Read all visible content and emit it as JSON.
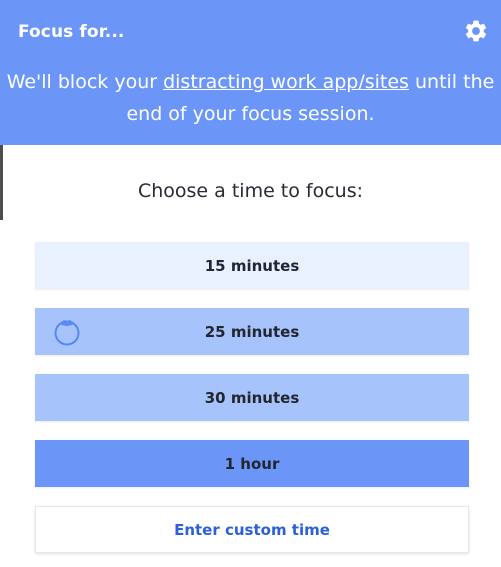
{
  "header": {
    "title": "Focus for...",
    "desc_before": "We'll block your ",
    "desc_link": "distracting work app/sites",
    "desc_after": " until the end of your focus session."
  },
  "prompt": "Choose a time to focus:",
  "options": [
    {
      "label": "15 minutes"
    },
    {
      "label": "25 minutes"
    },
    {
      "label": "30 minutes"
    },
    {
      "label": "1 hour"
    }
  ],
  "custom_label": "Enter custom time",
  "colors": {
    "header_bg": "#6b96f8",
    "option_15": "#e9f1ff",
    "option_25": "#a7c3fb",
    "option_30": "#a7c3fb",
    "option_60": "#6b96f8",
    "custom_text": "#2c5fd8"
  },
  "icons": {
    "settings": "gear-icon",
    "pomodoro": "tomato-icon"
  }
}
